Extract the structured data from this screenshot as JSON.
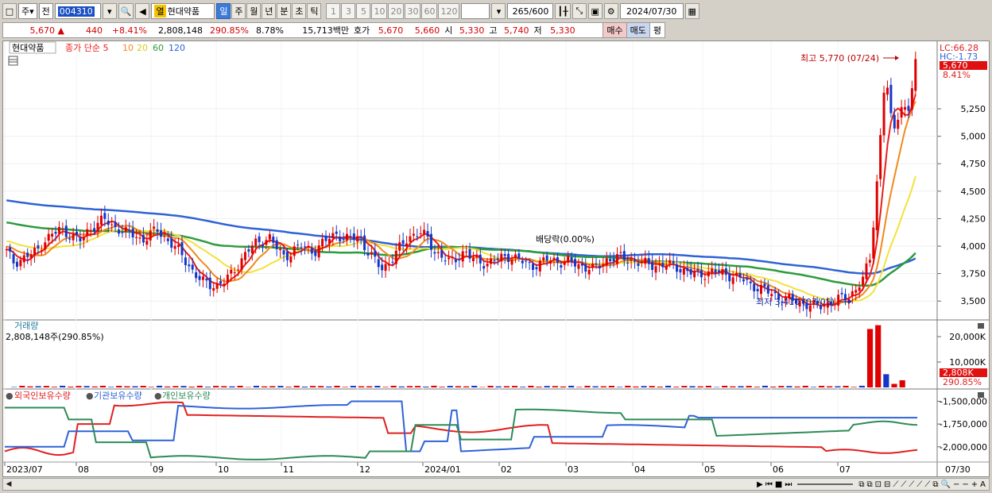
{
  "toolbar": {
    "type_label": "주",
    "market_label": "전",
    "code": "004310",
    "stock_tag": "열",
    "stock_name": "현대약품",
    "periods": [
      "일",
      "주",
      "월",
      "년",
      "분",
      "초",
      "틱"
    ],
    "active_period": "일",
    "intervals": [
      "1",
      "3",
      "5",
      "10",
      "20",
      "30",
      "60",
      "120"
    ],
    "count": "265",
    "count_total": "/600",
    "date": "2024/07/30"
  },
  "quote": {
    "price": "5,670",
    "arrow": "▲",
    "change": "440",
    "change_pct": "+8.41%",
    "volume": "2,808,148",
    "volume_ratio": "290.85%",
    "turnover": "8.78%",
    "amount": "15,713백만",
    "ask_label": "호가",
    "ask": "5,670",
    "bid": "5,660",
    "open_label": "시",
    "open": "5,330",
    "high_label": "고",
    "high": "5,740",
    "low_label": "저",
    "low": "5,330",
    "buy_label": "매수",
    "sell_label": "매도",
    "eval_label": "평"
  },
  "colors": {
    "up": "#e00000",
    "down": "#1537c8",
    "ma5": "#e8201a",
    "ma10": "#f08a1c",
    "ma20": "#f2e23a",
    "ma60": "#2e9b3e",
    "ma120": "#2f62d6",
    "foreign": "#e02020",
    "institution": "#2f62d6",
    "individual": "#2e8b57"
  },
  "price_panel": {
    "legend_name": "현대약품",
    "legend_ma": "종가 단순 5",
    "legend_ma_periods": [
      "10",
      "20",
      "60",
      "120"
    ],
    "lc": "LC:66.28",
    "hc": "HC:-1.73",
    "current_price": "5,670",
    "current_pct": "8.41%",
    "high_annotation": "최고 5,770 (07/24)",
    "low_annotation": "최저 3,410 (07/05)",
    "dividend_annotation": "배당락(0.00%)",
    "yticks": [
      "5,250",
      "5,000",
      "4,750",
      "4,500",
      "4,250",
      "4,000",
      "3,750",
      "3,500"
    ]
  },
  "volume_panel": {
    "title": "거래량",
    "value": "2,808,148주(290.85%)",
    "yticks": [
      "20,000K",
      "10,000K"
    ],
    "current": "2,808K",
    "current_pct": "290.85%"
  },
  "holdings_panel": {
    "legend_foreign": "외국인보유수량",
    "legend_institution": "기관보유수량",
    "legend_individual": "개인보유수량",
    "yticks": [
      "-1,500,000",
      "-1,750,000",
      "-2,000,000"
    ]
  },
  "x_axis": {
    "labels": [
      "2023/07",
      "08",
      "09",
      "10",
      "11",
      "12",
      "2024/01",
      "02",
      "03",
      "04",
      "05",
      "06",
      "07"
    ],
    "right_label": "07/30"
  },
  "chart_data": {
    "type": "candlestick",
    "x_labels": [
      "2023/07",
      "08",
      "09",
      "10",
      "11",
      "12",
      "2024/01",
      "02",
      "03",
      "04",
      "05",
      "06",
      "07"
    ],
    "ylim": [
      3350,
      5850
    ],
    "close": [
      [
        3950,
        3850,
        3880,
        3920,
        3950,
        4050,
        4100,
        4150,
        4120,
        4080,
        4050,
        4150,
        4200,
        4250,
        4180,
        4160,
        4120,
        4100
      ],
      [
        4050,
        4100,
        4150,
        4080,
        4020,
        3950,
        3850,
        3750,
        3680,
        3650,
        3640
      ],
      [
        3680,
        3750,
        3850,
        3950,
        4020,
        4050,
        4080,
        3980,
        3900,
        3950,
        4000
      ],
      [
        3980,
        3950,
        4020,
        4080,
        4120,
        4050,
        4080,
        4090,
        3950,
        3870,
        3800
      ],
      [
        3850,
        3950,
        4050,
        4100,
        4120,
        4080,
        3950,
        3900,
        3850
      ],
      [
        3900,
        3950,
        3880,
        3860,
        3840,
        3870,
        3900,
        3910
      ],
      [
        3880,
        3850,
        3820,
        3840,
        3880,
        3870,
        3850,
        3860,
        3830
      ],
      [
        3810,
        3790,
        3830,
        3880,
        3890,
        3900,
        3870,
        3850,
        3840,
        3830,
        3820
      ],
      [
        3830,
        3820,
        3780,
        3760,
        3740,
        3750,
        3770,
        3760
      ],
      [
        3740,
        3720,
        3700,
        3650,
        3620,
        3600,
        3560,
        3530,
        3520,
        3500
      ],
      [
        3480,
        3460,
        3450,
        3470,
        3500,
        3520,
        3540,
        3600,
        3700,
        3900,
        4700,
        5600,
        5000,
        5300,
        5200,
        5670
      ]
    ],
    "volume_spikes_k": [
      0,
      0,
      0,
      0,
      0,
      0,
      0,
      0,
      0,
      0,
      0,
      0,
      0,
      0,
      0,
      0,
      0,
      0,
      0,
      0,
      0,
      0,
      0,
      0,
      0,
      0,
      0,
      0,
      0,
      0,
      0,
      0,
      0,
      0,
      0,
      0,
      0,
      0,
      0,
      0,
      0,
      0,
      0,
      0,
      0,
      0,
      0,
      0,
      0,
      0,
      0,
      0,
      0,
      0,
      0,
      0,
      0,
      0,
      0,
      0,
      0,
      0,
      0,
      0,
      0,
      0,
      0,
      0,
      0,
      0,
      0,
      0,
      0,
      0,
      0,
      0,
      0,
      0,
      0,
      0,
      0,
      0,
      0,
      0,
      0,
      0,
      0,
      0,
      0,
      0,
      0,
      0,
      0,
      0,
      0,
      0,
      0,
      0,
      0,
      0,
      0,
      0,
      0,
      0,
      0,
      0,
      23000,
      24500,
      5200,
      1400,
      2808
    ]
  }
}
